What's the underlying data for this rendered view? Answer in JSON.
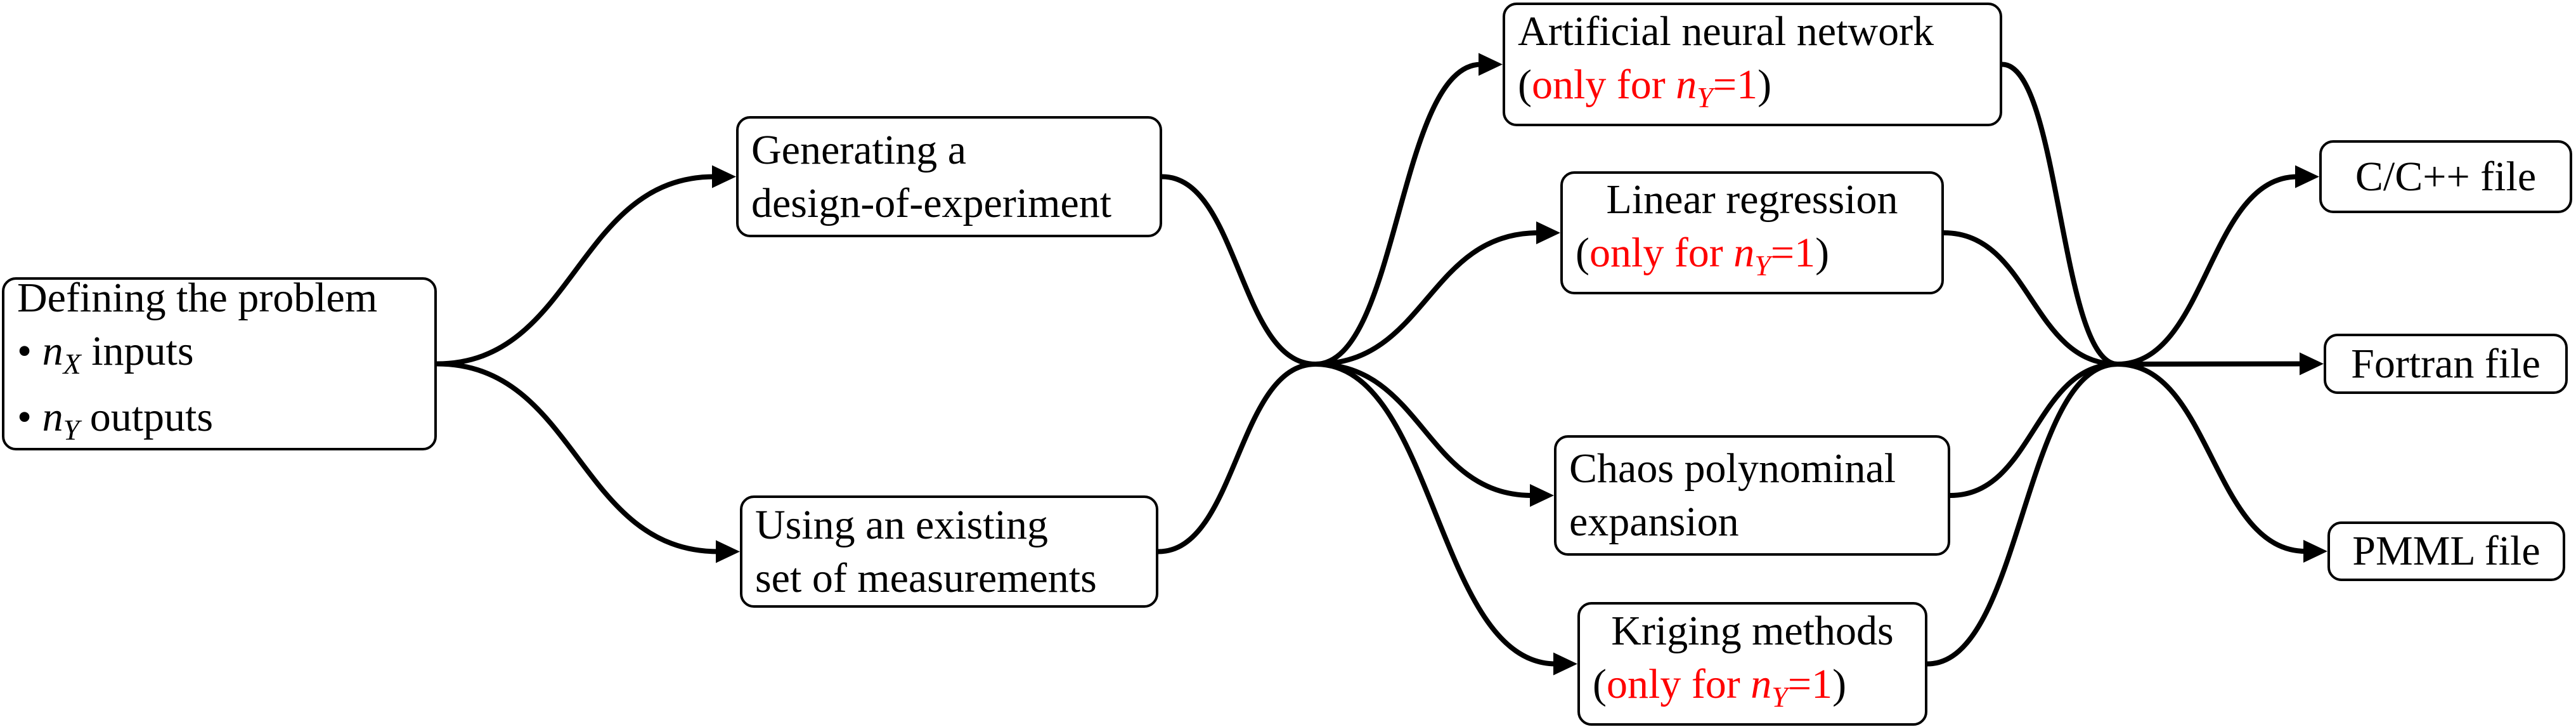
{
  "diagram": {
    "nodes": [
      {
        "id": "define",
        "name": "node-defining-problem",
        "lines": [
          [
            {
              "t": "Defining the problem"
            }
          ],
          [
            {
              "t": "• "
            },
            {
              "t": "n",
              "s": "math"
            },
            {
              "t": "X",
              "s": "sub"
            },
            {
              "t": " inputs"
            }
          ],
          [
            {
              "t": "• "
            },
            {
              "t": "n",
              "s": "math"
            },
            {
              "t": "Y",
              "s": "sub"
            },
            {
              "t": " outputs"
            }
          ]
        ]
      },
      {
        "id": "gen",
        "name": "node-generating-doe",
        "lines": [
          [
            {
              "t": "Generating a"
            }
          ],
          [
            {
              "t": "design-of-experiment"
            }
          ]
        ]
      },
      {
        "id": "use",
        "name": "node-existing-measurements",
        "lines": [
          [
            {
              "t": "Using an existing"
            }
          ],
          [
            {
              "t": "set of measurements"
            }
          ]
        ]
      },
      {
        "id": "ann",
        "name": "node-artificial-neural-network",
        "lines": [
          [
            {
              "t": "Artificial neural network"
            }
          ],
          [
            {
              "t": "("
            },
            {
              "t": "only for ",
              "s": "red"
            },
            {
              "t": "n",
              "s": "math red"
            },
            {
              "t": "Y",
              "s": "sub red"
            },
            {
              "t": "=1",
              "s": "red"
            },
            {
              "t": ")"
            }
          ]
        ]
      },
      {
        "id": "lin",
        "name": "node-linear-regression",
        "lines": [
          [
            {
              "t": "Linear regression"
            }
          ],
          [
            {
              "t": "("
            },
            {
              "t": "only for ",
              "s": "red"
            },
            {
              "t": "n",
              "s": "math red"
            },
            {
              "t": "Y",
              "s": "sub red"
            },
            {
              "t": "=1",
              "s": "red"
            },
            {
              "t": ")"
            }
          ]
        ]
      },
      {
        "id": "chaos",
        "name": "node-chaos-polynomial-expansion",
        "lines": [
          [
            {
              "t": "Chaos polynominal"
            }
          ],
          [
            {
              "t": "expansion"
            }
          ]
        ]
      },
      {
        "id": "krig",
        "name": "node-kriging-methods",
        "lines": [
          [
            {
              "t": "Kriging methods"
            }
          ],
          [
            {
              "t": "("
            },
            {
              "t": "only for ",
              "s": "red"
            },
            {
              "t": "n",
              "s": "math red"
            },
            {
              "t": "Y",
              "s": "sub red"
            },
            {
              "t": "=1",
              "s": "red"
            },
            {
              "t": ")"
            }
          ]
        ]
      },
      {
        "id": "c",
        "name": "node-c-cpp-file",
        "lines": [
          [
            {
              "t": "C/C++ file"
            }
          ]
        ]
      },
      {
        "id": "fortran",
        "name": "node-fortran-file",
        "lines": [
          [
            {
              "t": "Fortran file"
            }
          ]
        ]
      },
      {
        "id": "pmml",
        "name": "node-pmml-file",
        "lines": [
          [
            {
              "t": "PMML file"
            }
          ]
        ]
      }
    ],
    "edges": [
      {
        "from": "define",
        "to": "gen",
        "arrow": true
      },
      {
        "from": "define",
        "to": "use",
        "arrow": true
      },
      {
        "from": "gen",
        "to": "hub1",
        "arrow": false
      },
      {
        "from": "use",
        "to": "hub1",
        "arrow": false
      },
      {
        "from": "hub1",
        "to": "ann",
        "arrow": true
      },
      {
        "from": "hub1",
        "to": "lin",
        "arrow": true
      },
      {
        "from": "hub1",
        "to": "chaos",
        "arrow": true
      },
      {
        "from": "hub1",
        "to": "krig",
        "arrow": true
      },
      {
        "from": "ann",
        "to": "hub2",
        "arrow": false
      },
      {
        "from": "lin",
        "to": "hub2",
        "arrow": false
      },
      {
        "from": "chaos",
        "to": "hub2",
        "arrow": false
      },
      {
        "from": "krig",
        "to": "hub2",
        "arrow": false
      },
      {
        "from": "hub2",
        "to": "c",
        "arrow": true
      },
      {
        "from": "hub2",
        "to": "fortran",
        "arrow": true
      },
      {
        "from": "hub2",
        "to": "pmml",
        "arrow": true
      }
    ],
    "colors": {
      "text": "#000000",
      "highlight": "#ff0000",
      "edge": "#000000"
    }
  }
}
